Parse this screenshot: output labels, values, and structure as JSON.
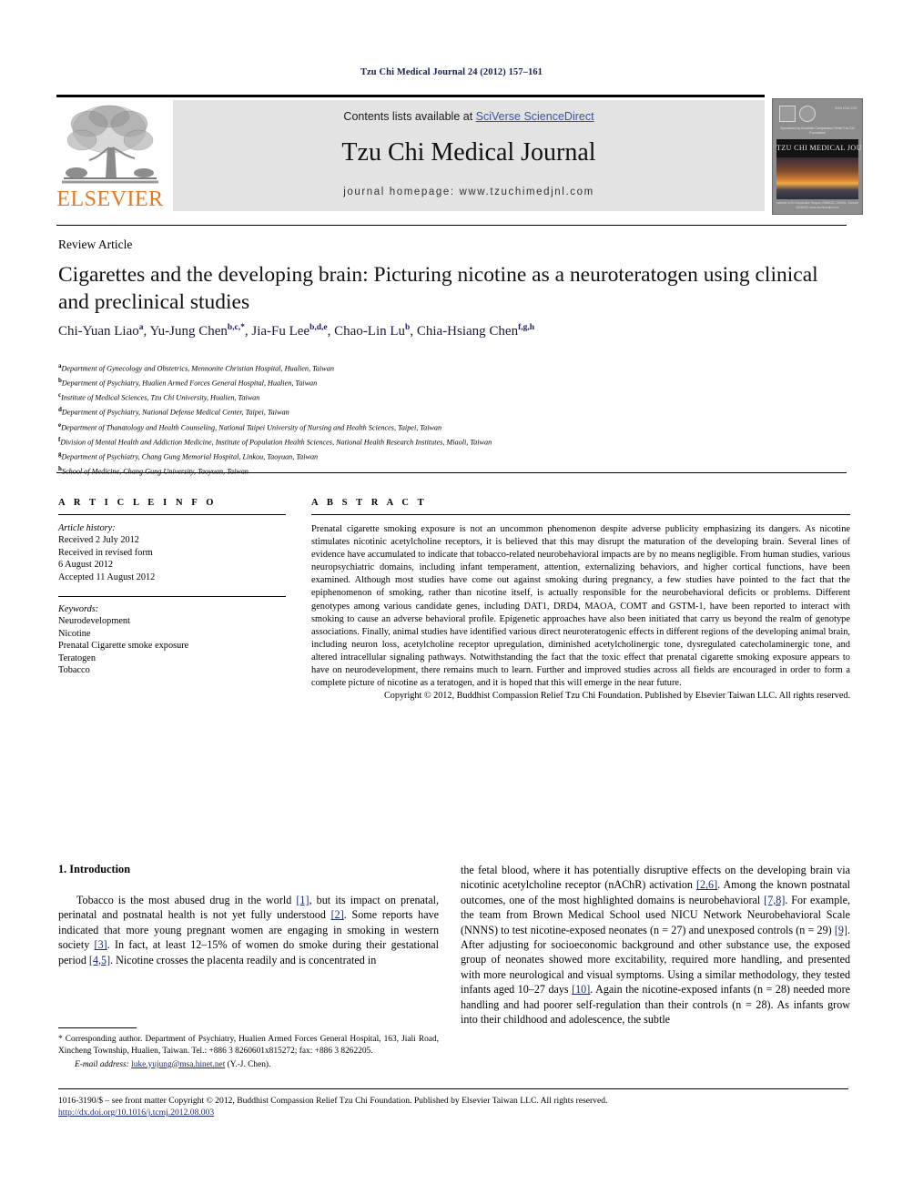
{
  "running_head": "Tzu Chi Medical Journal 24 (2012) 157–161",
  "masthead": {
    "contents_prefix": "Contents lists available at ",
    "sciencedirect": "SciVerse ScienceDirect",
    "journal_title": "Tzu Chi Medical Journal",
    "homepage": "journal homepage: www.tzuchimedjnl.com",
    "elsevier_wordmark": "ELSEVIER",
    "elsevier_color": "#e87722",
    "link_color": "#3a54a5",
    "cover": {
      "issn": "ISSN 1016-3190",
      "subtitle": "Sponsored by Buddhist Compassion\nRelief Tzu Chi Foundation",
      "name": "TZU CHI MEDICAL JOURNAL",
      "footer": "Indexed in SCI-Expanded, Scopus, EMBASE, CINAHL, Elsevier BIOBASE\nwww.tzuchimedjnl.com"
    }
  },
  "article": {
    "type": "Review Article",
    "title": "Cigarettes and the developing brain: Picturing nicotine as a neuroteratogen using clinical and preclinical studies",
    "authors": [
      {
        "name": "Chi-Yuan Liao",
        "sup": "a",
        "sep": ", "
      },
      {
        "name": "Yu-Jung Chen",
        "sup": "b,c,*",
        "sep": ", "
      },
      {
        "name": "Jia-Fu Lee",
        "sup": "b,d,e",
        "sep": ", "
      },
      {
        "name": "Chao-Lin Lu",
        "sup": "b",
        "sep": ", "
      },
      {
        "name": "Chia-Hsiang Chen",
        "sup": "f,g,h",
        "sep": ""
      }
    ],
    "affiliations": [
      {
        "mark": "a",
        "text": "Department of Gynecology and Obstetrics, Mennonite Christian Hospital, Hualien, Taiwan"
      },
      {
        "mark": "b",
        "text": "Department of Psychiatry, Hualien Armed Forces General Hospital, Hualien, Taiwan"
      },
      {
        "mark": "c",
        "text": "Institute of Medical Sciences, Tzu Chi University, Hualien, Taiwan"
      },
      {
        "mark": "d",
        "text": "Department of Psychiatry, National Defense Medical Center, Taipei, Taiwan"
      },
      {
        "mark": "e",
        "text": "Department of Thanatology and Health Counseling, National Taipei University of Nursing and Health Sciences, Taipei, Taiwan"
      },
      {
        "mark": "f",
        "text": "Division of Mental Health and Addiction Medicine, Institute of Population Health Sciences, National Health Research Institutes, Miaoli, Taiwan"
      },
      {
        "mark": "g",
        "text": "Department of Psychiatry, Chang Gung Memorial Hospital, Linkou, Taoyuan, Taiwan"
      },
      {
        "mark": "h",
        "text": "School of Medicine, Chang Gung University, Taoyuan, Taiwan"
      }
    ]
  },
  "article_info": {
    "heading": "A R T I C L E  I N F O",
    "history_label": "Article history:",
    "history": [
      "Received 2 July 2012",
      "Received in revised form",
      "6 August 2012",
      "Accepted 11 August 2012"
    ],
    "keywords_label": "Keywords:",
    "keywords": [
      "Neurodevelopment",
      "Nicotine",
      "Prenatal Cigarette smoke exposure",
      "Teratogen",
      "Tobacco"
    ]
  },
  "abstract": {
    "heading": "A B S T R A C T",
    "body": "Prenatal cigarette smoking exposure is not an uncommon phenomenon despite adverse publicity emphasizing its dangers. As nicotine stimulates nicotinic acetylcholine receptors, it is believed that this may disrupt the maturation of the developing brain. Several lines of evidence have accumulated to indicate that tobacco-related neurobehavioral impacts are by no means negligible. From human studies, various neuropsychiatric domains, including infant temperament, attention, externalizing behaviors, and higher cortical functions, have been examined. Although most studies have come out against smoking during pregnancy, a few studies have pointed to the fact that the epiphenomenon of smoking, rather than nicotine itself, is actually responsible for the neurobehavioral deficits or problems. Different genotypes among various candidate genes, including DAT1, DRD4, MAOA, COMT and GSTM-1, have been reported to interact with smoking to cause an adverse behavioral profile. Epigenetic approaches have also been initiated that carry us beyond the realm of genotype associations. Finally, animal studies have identified various direct neuroteratogenic effects in different regions of the developing animal brain, including neuron loss, acetylcholine receptor upregulation, diminished acetylcholinergic tone, dysregulated catecholaminergic tone, and altered intracellular signaling pathways. Notwithstanding the fact that the toxic effect that prenatal cigarette smoking exposure appears to have on neurodevelopment, there remains much to learn. Further and improved studies across all fields are encouraged in order to form a complete picture of nicotine as a teratogen, and it is hoped that this will emerge in the near future.",
    "copyright": "Copyright © 2012, Buddhist Compassion Relief Tzu Chi Foundation. Published by Elsevier Taiwan LLC. All rights reserved."
  },
  "introduction": {
    "heading": "1. Introduction",
    "left_paragraph_parts": [
      {
        "t": "Tobacco is the most abused drug in the world ",
        "ref": false
      },
      {
        "t": "[1]",
        "ref": true
      },
      {
        "t": ", but its impact on prenatal, perinatal and postnatal health is not yet fully understood ",
        "ref": false
      },
      {
        "t": "[2]",
        "ref": true
      },
      {
        "t": ". Some reports have indicated that more young pregnant women are engaging in smoking in western society ",
        "ref": false
      },
      {
        "t": "[3]",
        "ref": true
      },
      {
        "t": ". In fact, at least 12–15% of women do smoke during their gestational period ",
        "ref": false
      },
      {
        "t": "[4,5]",
        "ref": true
      },
      {
        "t": ". Nicotine crosses the placenta readily and is concentrated in",
        "ref": false
      }
    ],
    "right_paragraph_parts": [
      {
        "t": "the fetal blood, where it has potentially disruptive effects on the developing brain via nicotinic acetylcholine receptor (nAChR) activation ",
        "ref": false
      },
      {
        "t": "[2,6]",
        "ref": true
      },
      {
        "t": ". Among the known postnatal outcomes, one of the most highlighted domains is neurobehavioral ",
        "ref": false
      },
      {
        "t": "[7,8]",
        "ref": true
      },
      {
        "t": ". For example, the team from Brown Medical School used NICU Network Neurobehavioral Scale (NNNS) to test nicotine-exposed neonates (n = 27) and unexposed controls (n = 29) ",
        "ref": false
      },
      {
        "t": "[9]",
        "ref": true
      },
      {
        "t": ". After adjusting for socioeconomic background and other substance use, the exposed group of neonates showed more excitability, required more handling, and presented with more neurological and visual symptoms. Using a similar methodology, they tested infants aged 10–27 days ",
        "ref": false
      },
      {
        "t": "[10]",
        "ref": true
      },
      {
        "t": ". Again the nicotine-exposed infants (n = 28) needed more handling and had poorer self-regulation than their controls (n = 28). As infants grow into their childhood and adolescence, the subtle",
        "ref": false
      }
    ]
  },
  "footnote": {
    "corresponding": "* Corresponding author. Department of Psychiatry, Hualien Armed Forces General Hospital, 163, Jiali Road, Xincheng Township, Hualien, Taiwan. Tel.: +886 3 8260601x815272; fax: +886 3 8262205.",
    "email_label": "E-mail address:",
    "email": "luke.yujung@msa.hinet.net",
    "email_suffix": "(Y.-J. Chen)."
  },
  "bottom": {
    "front_matter": "1016-3190/$ – see front matter Copyright © 2012, Buddhist Compassion Relief Tzu Chi Foundation. Published by Elsevier Taiwan LLC. All rights reserved.",
    "doi": "http://dx.doi.org/10.1016/j.tcmj.2012.08.003"
  }
}
